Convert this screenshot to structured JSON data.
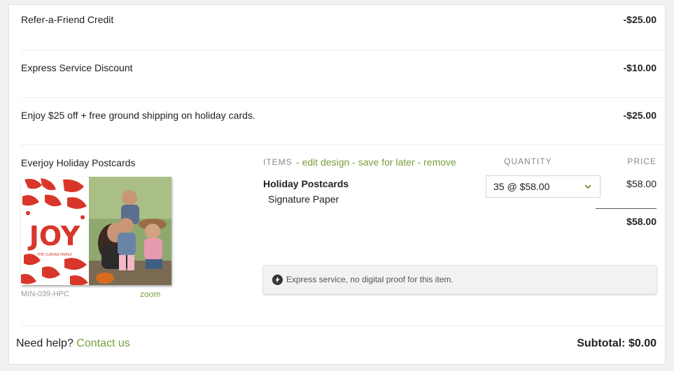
{
  "discounts": [
    {
      "label": "Refer-a-Friend Credit",
      "amount": "-$25.00"
    },
    {
      "label": "Express Service Discount",
      "amount": "-$10.00"
    },
    {
      "label": "Enjoy $25 off + free ground shipping on holiday cards.",
      "amount": "-$25.00"
    }
  ],
  "product": {
    "name": "Everjoy Holiday Postcards",
    "sku": "MIN-039-HPC",
    "zoom_label": "zoom",
    "card_text": "JOY",
    "card_family": "THE CUEVAS FAMILY"
  },
  "item_header": {
    "items_label": "ITEMS",
    "edit_label": "edit design",
    "save_label": "save for later",
    "remove_label": "remove",
    "dash1": "-",
    "dash2": "-",
    "dash3": "-",
    "quantity_label": "QUANTITY",
    "price_label": "PRICE"
  },
  "item": {
    "title": "Holiday Postcards",
    "paper": "Signature Paper",
    "quantity_value": "35 @ $58.00",
    "price": "$58.00",
    "price_total": "$58.00"
  },
  "notice": {
    "text": "Express service, no digital proof for this item.",
    "icon": "lightning-bolt-icon"
  },
  "footer": {
    "help_text": "Need help?",
    "contact_label": "Contact us",
    "subtotal": "Subtotal: $0.00"
  },
  "colors": {
    "accent_green": "#7a9e3c",
    "card_red": "#d9362b"
  }
}
